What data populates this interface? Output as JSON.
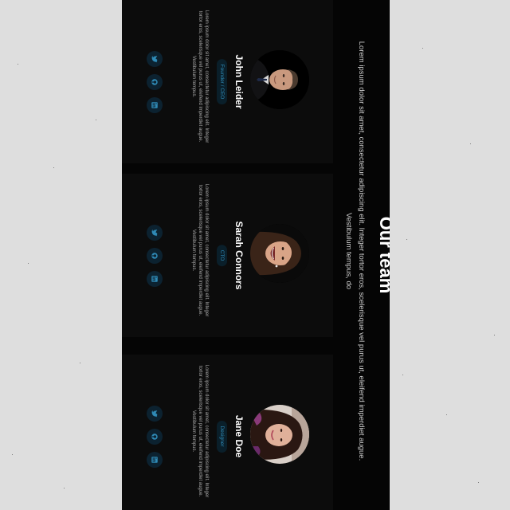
{
  "section": {
    "title": "Our team",
    "subtitle": "Lorem ipsum dolor sit amet, consectetur adipiscing elit. Integer tortor eros, scelerisque vel purus ut, eleifend imperdiet augue. Vestibulum tempus, do"
  },
  "members": [
    {
      "name": "John Leider",
      "role": "Founder / CEO",
      "bio": "Lorem ipsum dolor sit amet, consectetur adipiscing elit. Integer tortor eros, scelerisque vel purus ut, eleifend imperdiet augue. Vestibulum tempus."
    },
    {
      "name": "Sarah Connors",
      "role": "CTO",
      "bio": "Lorem ipsum dolor sit amet, consectetur adipiscing elit. Integer tortor eros, scelerisque vel purus ut, eleifend imperdiet augue. Vestibulum tempus."
    },
    {
      "name": "Jane Doe",
      "role": "Designer",
      "bio": "Lorem ipsum dolor sit amet, consectetur adipiscing elit. Integer tortor eros, scelerisque vel purus ut, eleifend imperdiet augue. Vestibulum tempus."
    }
  ],
  "social_icons": [
    "twitter-icon",
    "github-icon",
    "linkedin-icon"
  ],
  "colors": {
    "page_bg": "#dedede",
    "panel_bg": "#050505",
    "card_bg": "#0c0c0c",
    "accent": "#2f8ab6",
    "chip_bg": "#0a1f2a",
    "icon_bg": "#0c2230"
  }
}
